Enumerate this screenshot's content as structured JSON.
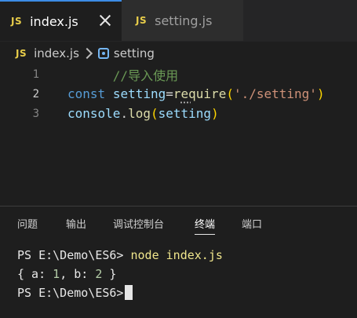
{
  "tabs": [
    {
      "badge": "JS",
      "label": "index.js",
      "active": true
    },
    {
      "badge": "JS",
      "label": "setting.js",
      "active": false
    }
  ],
  "breadcrumb": {
    "file_badge": "JS",
    "file": "index.js",
    "symbol": "setting"
  },
  "editor": {
    "current_line": 2,
    "lines": [
      {
        "number": "1",
        "comment": "//导入使用"
      },
      {
        "number": "2",
        "keyword": "const",
        "var": "setting",
        "op": "=",
        "fn": "require",
        "open": "(",
        "str": "'./setting'",
        "close": ")"
      },
      {
        "number": "3",
        "obj": "console",
        "dot": ".",
        "method": "log",
        "open": "(",
        "arg": "setting",
        "close": ")"
      }
    ]
  },
  "panel": {
    "tabs": [
      "问题",
      "输出",
      "调试控制台",
      "终端",
      "端口"
    ],
    "active_tab": "终端"
  },
  "terminal": {
    "prompt1": "PS E:\\Demo\\ES6> ",
    "command": "node index.js",
    "output_open": "{ a: ",
    "a_val": "1",
    "output_mid": ", b: ",
    "b_val": "2",
    "output_close": " }",
    "prompt2": "PS E:\\Demo\\ES6>"
  },
  "colors": {
    "background": "#1e1e1e",
    "js_badge": "#e8cd4a",
    "active_tab_border": "#3c8ce6"
  }
}
